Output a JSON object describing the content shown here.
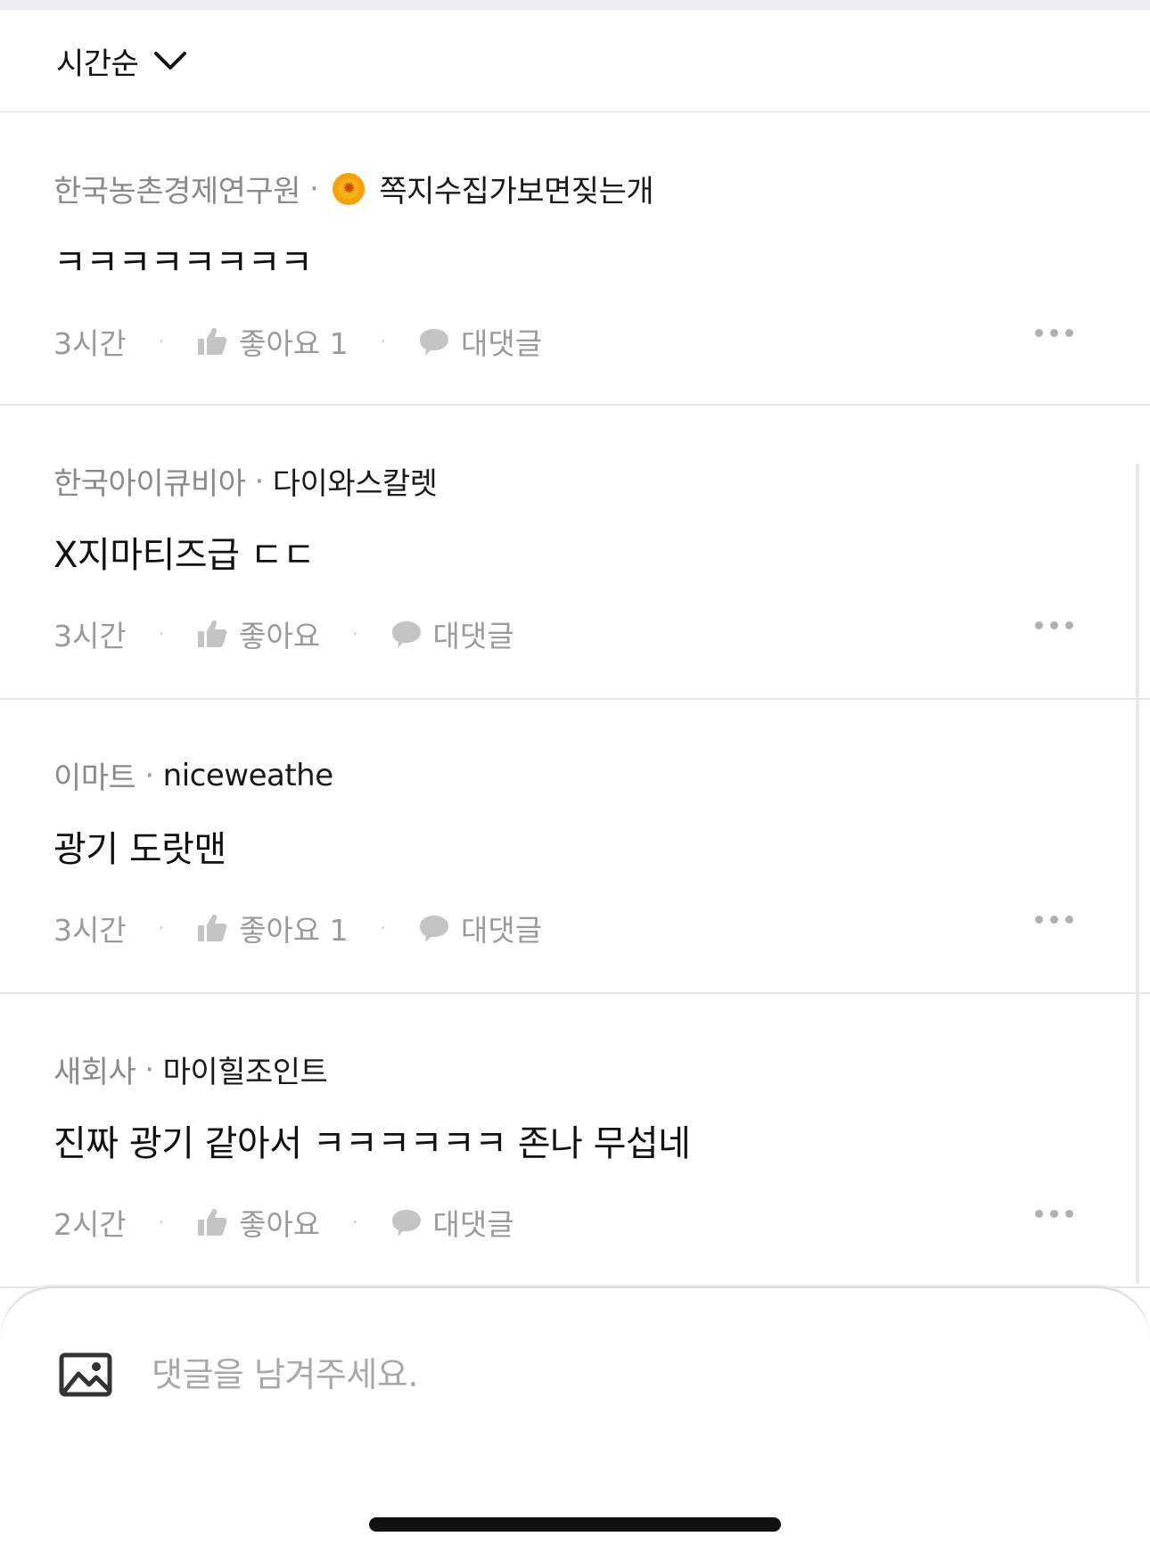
{
  "sort": {
    "label": "시간순"
  },
  "comments": [
    {
      "company": "한국농촌경제연구원",
      "nickname": "쪽지수집가보면짖는개",
      "has_badge": true,
      "text": "ㅋㅋㅋㅋㅋㅋㅋㅋ",
      "time": "3시간",
      "like_label": "좋아요 1",
      "reply_label": "대댓글"
    },
    {
      "company": "한국아이큐비아",
      "nickname": "다이와스칼렛",
      "has_badge": false,
      "text": "X지마티즈급 ㄷㄷ",
      "time": "3시간",
      "like_label": "좋아요",
      "reply_label": "대댓글"
    },
    {
      "company": "이마트",
      "nickname": "niceweathe",
      "has_badge": false,
      "text": "광기 도랏맨",
      "time": "3시간",
      "like_label": "좋아요 1",
      "reply_label": "대댓글"
    },
    {
      "company": "새회사",
      "nickname": "마이힐조인트",
      "has_badge": false,
      "text": "진짜 광기 같아서 ㅋㅋㅋㅋㅋㅋ 존나 무섭네",
      "time": "2시간",
      "like_label": "좋아요",
      "reply_label": "대댓글"
    }
  ],
  "compose": {
    "placeholder": "댓글을 남겨주세요."
  },
  "separator": "·",
  "icons": {
    "sort": "chevron-down-icon",
    "like": "thumbs-up-icon",
    "reply": "speech-bubble-icon",
    "more": "more-horizontal-icon",
    "badge": "sun-badge-icon",
    "attach": "image-icon"
  }
}
